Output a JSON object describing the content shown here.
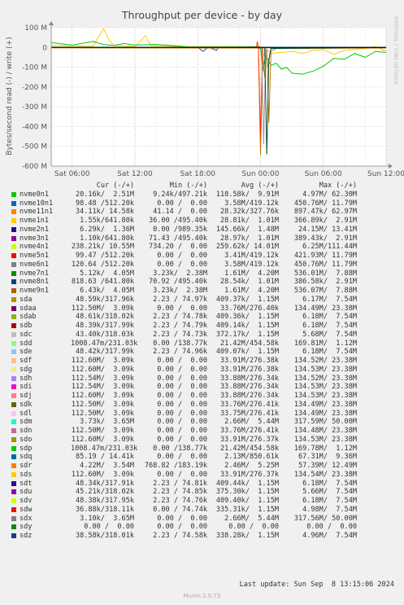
{
  "chart_data": {
    "type": "line",
    "title": "Throughput per device - by day",
    "ylabel": "Bytes/second read (-) / write (+)",
    "ylim": [
      -600000000,
      100000000
    ],
    "y_ticks": [
      {
        "value": 100000000,
        "label": "100 M"
      },
      {
        "value": 0,
        "label": "0"
      },
      {
        "value": -100000000,
        "label": "-100 M"
      },
      {
        "value": -200000000,
        "label": "-200 M"
      },
      {
        "value": -300000000,
        "label": "-300 M"
      },
      {
        "value": -400000000,
        "label": "-400 M"
      },
      {
        "value": -500000000,
        "label": "-500 M"
      },
      {
        "value": -600000000,
        "label": "-600 M"
      }
    ],
    "xlim": [
      0,
      32
    ],
    "x_unit": "hours since Sat 04:00",
    "x_ticks": [
      {
        "value": 2,
        "label": "Sat 06:00"
      },
      {
        "value": 8,
        "label": "Sat 12:00"
      },
      {
        "value": 14,
        "label": "Sat 18:00"
      },
      {
        "value": 20,
        "label": "Sun 00:00"
      },
      {
        "value": 26,
        "label": "Sun 06:00"
      },
      {
        "value": 32,
        "label": "Sun 12:00"
      }
    ],
    "grid": true,
    "series": [
      {
        "name": "nvme11n1",
        "color": "#ffcc00",
        "points": [
          [
            0,
            10
          ],
          [
            2,
            8
          ],
          [
            4,
            6
          ],
          [
            5,
            95
          ],
          [
            5.5,
            40
          ],
          [
            6,
            10
          ],
          [
            8,
            5
          ],
          [
            9,
            60
          ],
          [
            9.5,
            10
          ],
          [
            12,
            5
          ],
          [
            16,
            4
          ],
          [
            20,
            4
          ],
          [
            20.3,
            -40
          ],
          [
            20.6,
            -10
          ],
          [
            21,
            -30
          ],
          [
            22,
            -25
          ],
          [
            23,
            -20
          ],
          [
            24,
            -30
          ],
          [
            25,
            -15
          ],
          [
            26,
            -10
          ],
          [
            27,
            -35
          ],
          [
            28,
            -15
          ],
          [
            29,
            -10
          ],
          [
            30,
            -5
          ],
          [
            31,
            5
          ],
          [
            32,
            -20
          ]
        ]
      },
      {
        "name": "sdd",
        "color": "#00cc00",
        "points": [
          [
            0,
            25
          ],
          [
            1,
            18
          ],
          [
            2,
            12
          ],
          [
            4,
            30
          ],
          [
            5,
            15
          ],
          [
            6,
            10
          ],
          [
            7,
            20
          ],
          [
            8,
            12
          ],
          [
            10,
            15
          ],
          [
            12,
            8
          ],
          [
            13,
            2
          ],
          [
            16,
            2
          ],
          [
            19,
            2
          ],
          [
            20,
            2
          ],
          [
            20.2,
            -120
          ],
          [
            20.5,
            -40
          ],
          [
            21,
            -90
          ],
          [
            21.5,
            -80
          ],
          [
            22,
            -110
          ],
          [
            22.5,
            -100
          ],
          [
            23,
            -130
          ],
          [
            24,
            -135
          ],
          [
            25,
            -120
          ],
          [
            26,
            -95
          ],
          [
            27,
            -55
          ],
          [
            28,
            -60
          ],
          [
            29,
            -30
          ],
          [
            30,
            -50
          ],
          [
            31,
            -20
          ],
          [
            32,
            -25
          ]
        ]
      },
      {
        "name": "nvme10n1",
        "color": "#0066b3",
        "points": [
          [
            0,
            1
          ],
          [
            14,
            1
          ],
          [
            14.5,
            -20
          ],
          [
            15,
            2
          ],
          [
            15.8,
            -15
          ],
          [
            16,
            1
          ],
          [
            19.5,
            2
          ],
          [
            20,
            -5
          ],
          [
            20.5,
            1
          ],
          [
            32,
            1
          ]
        ]
      },
      {
        "name": "sdo",
        "color": "#cc7700",
        "points": [
          [
            0,
            -2
          ],
          [
            19.8,
            -3
          ],
          [
            20,
            -545
          ],
          [
            20.2,
            -40
          ],
          [
            20.4,
            -150
          ],
          [
            20.6,
            -10
          ],
          [
            20.8,
            -380
          ],
          [
            21,
            -20
          ],
          [
            21.5,
            -5
          ],
          [
            32,
            -3
          ]
        ]
      },
      {
        "name": "sdr",
        "color": "#ff3300",
        "points": [
          [
            0,
            0
          ],
          [
            19.6,
            0
          ],
          [
            19.7,
            30
          ],
          [
            19.8,
            -5
          ],
          [
            20,
            -460
          ],
          [
            20.2,
            -2
          ],
          [
            32,
            0
          ]
        ]
      },
      {
        "name": "sdh",
        "color": "#999999",
        "points": [
          [
            0,
            0
          ],
          [
            20.1,
            0
          ],
          [
            20.3,
            -490
          ],
          [
            20.5,
            0
          ],
          [
            20.7,
            -100
          ],
          [
            21,
            -5
          ],
          [
            32,
            0
          ]
        ]
      },
      {
        "name": "sdx",
        "color": "#004c33",
        "points": [
          [
            0,
            1
          ],
          [
            20.4,
            1
          ],
          [
            20.6,
            -540
          ],
          [
            20.8,
            -60
          ],
          [
            21,
            -5
          ],
          [
            32,
            0
          ]
        ]
      }
    ]
  },
  "side_label": "RRDTOOL / TOBI OETIKER",
  "legend": {
    "header": {
      "cur": "Cur (-/+)",
      "min": "Min (-/+)",
      "avg": "Avg (-/+)",
      "max": "Max (-/+)"
    },
    "rows": [
      {
        "name": "nvme0n1",
        "color": "#00cc00",
        "cur": "20.16k/  2.51M",
        "min": "9.24k/497.21k",
        "avg": "118.58k/  9.91M",
        "max": "4.97M/ 62.30M"
      },
      {
        "name": "nvme10n1",
        "color": "#0066b3",
        "cur": "98.48 /512.20k",
        "min": "0.00 /  0.00",
        "avg": "3.58M/419.12k",
        "max": "450.76M/ 11.79M"
      },
      {
        "name": "nvme11n1",
        "color": "#ff8000",
        "cur": "34.11k/ 14.58k",
        "min": "41.14 /  0.00",
        "avg": "28.32k/327.76k",
        "max": "897.47k/ 62.97M"
      },
      {
        "name": "nvme1n1",
        "color": "#ffcc00",
        "cur": "1.55k/641.80k",
        "min": "36.00 /495.40k",
        "avg": "28.81k/  1.01M",
        "max": "366.89k/  2.91M"
      },
      {
        "name": "nvme2n1",
        "color": "#330099",
        "cur": "6.29k/  1.36M",
        "min": "0.00 /989.35k",
        "avg": "145.66k/  1.48M",
        "max": "24.15M/ 13.41M"
      },
      {
        "name": "nvme3n1",
        "color": "#990099",
        "cur": "1.10k/641.80k",
        "min": "71.43 /495.40k",
        "avg": "28.97k/  1.01M",
        "max": "389.43k/  2.91M"
      },
      {
        "name": "nvme4n1",
        "color": "#ccff00",
        "cur": "238.21k/ 10.55M",
        "min": "734.20 /  0.00",
        "avg": "259.62k/ 14.01M",
        "max": "6.25M/111.44M"
      },
      {
        "name": "nvme5n1",
        "color": "#ff0000",
        "cur": "99.47 /512.20k",
        "min": "0.00 /  0.00",
        "avg": "3.41M/419.12k",
        "max": "421.93M/ 11.79M"
      },
      {
        "name": "nvme6n1",
        "color": "#808080",
        "cur": "120.64 /512.20k",
        "min": "0.00 /  0.00",
        "avg": "3.58M/419.12k",
        "max": "450.76M/ 11.79M"
      },
      {
        "name": "nvme7n1",
        "color": "#008f00",
        "cur": "5.12k/  4.05M",
        "min": "3.23k/  2.38M",
        "avg": "1.61M/  4.20M",
        "max": "536.01M/  7.88M"
      },
      {
        "name": "nvme8n1",
        "color": "#00487d",
        "cur": "818.63 /641.80k",
        "min": "70.92 /495.40k",
        "avg": "28.54k/  1.01M",
        "max": "386.58k/  2.91M"
      },
      {
        "name": "nvme9n1",
        "color": "#b35a00",
        "cur": "6.43k/  4.05M",
        "min": "3.23k/  2.38M",
        "avg": "1.61M/  4.20M",
        "max": "536.07M/  7.88M"
      },
      {
        "name": "sda",
        "color": "#b38f00",
        "cur": "48.59k/317.96k",
        "min": "2.23 / 74.97k",
        "avg": "409.37k/  1.15M",
        "max": "6.17M/  7.54M"
      },
      {
        "name": "sdaa",
        "color": "#6b006b",
        "cur": "112.50M/  3.09k",
        "min": "0.00 /  0.00",
        "avg": "33.76M/276.40k",
        "max": "134.49M/ 23.38M"
      },
      {
        "name": "sdab",
        "color": "#8fb300",
        "cur": "48.61k/318.02k",
        "min": "2.23 / 74.78k",
        "avg": "409.36k/  1.15M",
        "max": "6.18M/  7.54M"
      },
      {
        "name": "sdb",
        "color": "#b30000",
        "cur": "48.39k/317.99k",
        "min": "2.23 / 74.79k",
        "avg": "409.14k/  1.15M",
        "max": "6.18M/  7.54M"
      },
      {
        "name": "sdc",
        "color": "#bebebe",
        "cur": "43.40k/318.03k",
        "min": "2.23 / 74.73k",
        "avg": "372.17k/  1.15M",
        "max": "5.68M/  7.54M"
      },
      {
        "name": "sdd",
        "color": "#80ff80",
        "cur": "1008.47m/231.03k",
        "min": "0.00 /138.77k",
        "avg": "21.42M/454.58k",
        "max": "169.81M/  1.12M"
      },
      {
        "name": "sde",
        "color": "#80c9ff",
        "cur": "48.42k/317.99k",
        "min": "2.23 / 74.96k",
        "avg": "409.07k/  1.15M",
        "max": "6.18M/  7.54M"
      },
      {
        "name": "sdf",
        "color": "#ffc080",
        "cur": "112.60M/  3.09k",
        "min": "0.00 /  0.00",
        "avg": "33.91M/276.38k",
        "max": "134.52M/ 23.38M"
      },
      {
        "name": "sdg",
        "color": "#ffe680",
        "cur": "112.60M/  3.09k",
        "min": "0.00 /  0.00",
        "avg": "33.91M/276.38k",
        "max": "134.53M/ 23.38M"
      },
      {
        "name": "sdh",
        "color": "#aa80ff",
        "cur": "112.54M/  3.09k",
        "min": "0.00 /  0.00",
        "avg": "33.88M/276.34k",
        "max": "134.52M/ 23.38M"
      },
      {
        "name": "sdi",
        "color": "#ee00cc",
        "cur": "112.54M/  3.09k",
        "min": "0.00 /  0.00",
        "avg": "33.88M/276.34k",
        "max": "134.53M/ 23.38M"
      },
      {
        "name": "sdj",
        "color": "#ff8080",
        "cur": "112.60M/  3.09k",
        "min": "0.00 /  0.00",
        "avg": "33.88M/276.34k",
        "max": "134.53M/ 23.38M"
      },
      {
        "name": "sdk",
        "color": "#666600",
        "cur": "112.50M/  3.09k",
        "min": "0.00 /  0.00",
        "avg": "33.76M/276.41k",
        "max": "134.49M/ 23.38M"
      },
      {
        "name": "sdl",
        "color": "#ffbfff",
        "cur": "112.50M/  3.09k",
        "min": "0.00 /  0.00",
        "avg": "33.75M/276.41k",
        "max": "134.49M/ 23.38M"
      },
      {
        "name": "sdm",
        "color": "#00ffcc",
        "cur": "3.73k/  3.65M",
        "min": "0.00 /  0.00",
        "avg": "2.66M/  5.44M",
        "max": "317.59M/ 50.00M"
      },
      {
        "name": "sdn",
        "color": "#cc6699",
        "cur": "112.50M/  3.09k",
        "min": "0.00 /  0.00",
        "avg": "33.76M/276.41k",
        "max": "134.48M/ 23.38M"
      },
      {
        "name": "sdo",
        "color": "#999900",
        "cur": "112.60M/  3.09k",
        "min": "0.00 /  0.00",
        "avg": "33.91M/276.37k",
        "max": "134.53M/ 23.38M"
      },
      {
        "name": "sdp",
        "color": "#00cc00",
        "cur": "1008.47m/231.03k",
        "min": "0.00 /138.77k",
        "avg": "21.42M/454.58k",
        "max": "169.78M/  1.12M"
      },
      {
        "name": "sdq",
        "color": "#0066b3",
        "cur": "85.19 / 14.41k",
        "min": "0.00 /  0.00",
        "avg": "2.13M/850.61k",
        "max": "67.31M/  9.36M"
      },
      {
        "name": "sdr",
        "color": "#ff8000",
        "cur": "4.22M/  3.54M",
        "min": "768.82 /183.19k",
        "avg": "2.46M/  5.25M",
        "max": "57.39M/ 12.49M"
      },
      {
        "name": "sds",
        "color": "#ffcc00",
        "cur": "112.60M/  3.09k",
        "min": "0.00 /  0.00",
        "avg": "33.91M/276.37k",
        "max": "134.54M/ 23.38M"
      },
      {
        "name": "sdt",
        "color": "#330099",
        "cur": "48.34k/317.91k",
        "min": "2.23 / 74.81k",
        "avg": "409.44k/  1.15M",
        "max": "6.18M/  7.54M"
      },
      {
        "name": "sdu",
        "color": "#990099",
        "cur": "45.21k/318.02k",
        "min": "2.23 / 74.85k",
        "avg": "375.30k/  1.15M",
        "max": "5.66M/  7.54M"
      },
      {
        "name": "sdv",
        "color": "#ccff00",
        "cur": "48.38k/317.95k",
        "min": "2.23 / 74.76k",
        "avg": "409.40k/  1.15M",
        "max": "6.18M/  7.54M"
      },
      {
        "name": "sdw",
        "color": "#ff0000",
        "cur": "36.88k/318.11k",
        "min": "0.00 / 74.74k",
        "avg": "335.31k/  1.15M",
        "max": "4.98M/  7.54M"
      },
      {
        "name": "sdx",
        "color": "#808080",
        "cur": "3.10k/  3.65M",
        "min": "0.00 /  0.00",
        "avg": "2.66M/  5.44M",
        "max": "317.56M/ 50.00M"
      },
      {
        "name": "sdy",
        "color": "#008f00",
        "cur": "0.00 /  0.00",
        "min": "0.00 /  0.00",
        "avg": "0.00 /  0.00",
        "max": "0.00 /  0.00"
      },
      {
        "name": "sdz",
        "color": "#00487d",
        "cur": "38.58k/318.01k",
        "min": "2.23 / 74.58k",
        "avg": "338.28k/  1.15M",
        "max": "4.96M/  7.54M"
      }
    ]
  },
  "last_update": "Last update: Sun Sep  8 13:15:06 2024",
  "footer": "Munin 2.0.73"
}
